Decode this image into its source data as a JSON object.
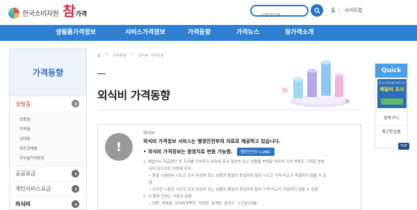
{
  "header": {
    "logo_text": "한국소비자원",
    "logo_sub_main": "참",
    "logo_sub_small": "가격",
    "search_placeholder": "상품명입력",
    "links": [
      "홈",
      "사이트맵"
    ]
  },
  "nav": {
    "items": [
      "생필품가격정보",
      "서비스가격정보",
      "가격동향",
      "가격뉴스",
      "참가격소개"
    ]
  },
  "sidebar": {
    "title": "가격동향",
    "categories": [
      {
        "label": "생필품",
        "subs": [
          "상품별",
          "지역별",
          "업태별",
          "제조업체별",
          "주차별가격동향"
        ]
      },
      {
        "label": "공공요금"
      },
      {
        "label": "개인서비스요금"
      },
      {
        "label": "외식비"
      }
    ]
  },
  "breadcrumb": [
    "홈",
    "가격동향",
    "외식비 가격동향"
  ],
  "page": {
    "title": "외식비 가격동향"
  },
  "info": {
    "category": "외식비",
    "line1": "외식비 가격정보 서비스는 행정안전부의 자료로 제공하고 있습니다.",
    "line2": "• 외식비 가격정보는 참정치로 변동 가능함.",
    "link_label": "행정안전부 (LINK)",
    "notes": [
      "1. 폐업이나 취급중단 등 조사를 지속하기 어려워 조사 대상처 또는 상품을 변경할 경우의 가격 변동도 그대로 반영",
      "되어 있으므로 이용에 주의",
      "• 동일 시점에서 시도간 조사 대상처 또는 상품의 품질이 동일하지 않아 시도간 가격 비교가 적절하지 않을 수 있",
      "음",
      "• 상이한 시점간 시도의 조사 대상처 또는 상품의 품질이 동일하지 않아 가격 비교가 적절하지 않을 수 있음",
      "2. 각 품목 단위는 다음과 같음",
      "• 냉면, 비빔밥, 김치찌개백반, 자장면, 삼계탕, 칼국수 : 1인분(보통)"
    ]
  },
  "quick": {
    "title": "Quick",
    "banner_small": "한국소비자원 바로가기",
    "banner_title": "배달비 조사",
    "links": [
      "장바구니",
      "최근본상품"
    ],
    "top_label": "TOP"
  },
  "colors": {
    "nav_blue": "#2f80d1",
    "accent_blue": "#2a74c7",
    "quick_blue": "#4aa0e6"
  }
}
